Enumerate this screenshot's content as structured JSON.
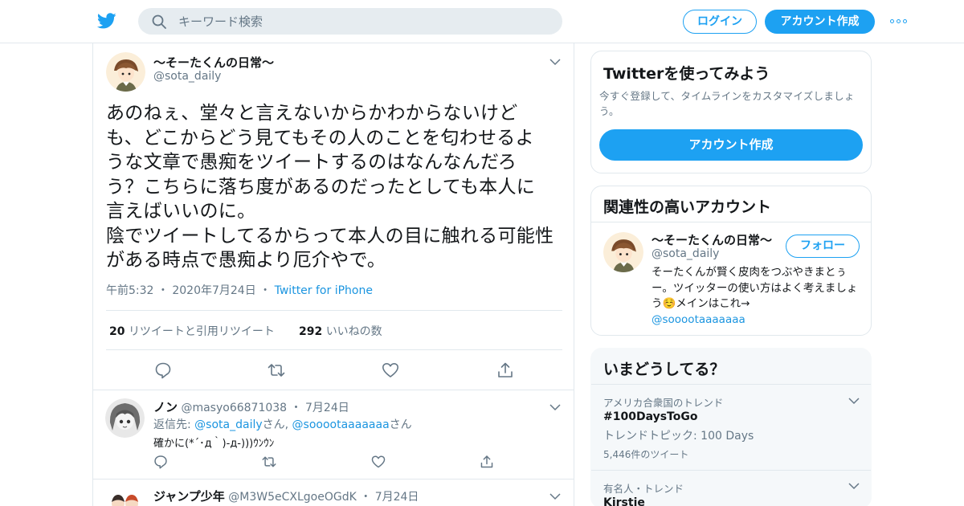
{
  "header": {
    "search_placeholder": "キーワード検索",
    "login_label": "ログイン",
    "signup_label": "アカウント作成"
  },
  "tweet": {
    "display_name": "〜そーたくんの日常〜",
    "handle": "@sota_daily",
    "text": "あのねぇ、堂々と言えないからかわからないけど\nも、どこからどう見てもその人のことを匂わせるよ\nうな文章で愚痴をツイートするのはなんなんだろ\nう？こちらに落ち度があるのだったとしても本人に\n言えばいいのに。\n陰でツイートしてるからって本人の目に触れる可能性\nがある時点で愚痴より厄介やで。",
    "time": "午前5:32",
    "date": "2020年7月24日",
    "source": "Twitter for iPhone",
    "retweets_count": "20",
    "retweets_label": "リツイートと引用リツイート",
    "likes_count": "292",
    "likes_label": "いいねの数"
  },
  "replies": [
    {
      "name": "ノン",
      "handle": "@masyo66871038",
      "date": "7月24日",
      "reply_to_prefix": "返信先: ",
      "reply_to_1": "@sota_daily",
      "san_1": "さん",
      "sep": ", ",
      "reply_to_2": "@sooootaaaaaaa",
      "san_2": "さん",
      "text": "確かに(*´･д｀)-д-)))ｳﾝｳﾝ"
    },
    {
      "name": "ジャンプ少年",
      "handle": "@M3W5eCXLgoeOGdK",
      "date": "7月24日"
    }
  ],
  "signup_card": {
    "title": "Twitterを使ってみよう",
    "desc": "今すぐ登録して、タイムラインをカスタマイズしましょう。",
    "button": "アカウント作成"
  },
  "related": {
    "title": "関連性の高いアカウント",
    "name": "〜そーたくんの日常〜",
    "handle": "@sota_daily",
    "follow": "フォロー",
    "bio": "そーたくんが賢く皮肉をつぶやきまとぅー。ツイッターの使い方はよく考えましょう☺️メインはこれ→",
    "bio_link": "@sooootaaaaaaa"
  },
  "trends": {
    "title": "いまどうしてる？",
    "items": [
      {
        "context": "アメリカ合衆国のトレンド",
        "name": "#100DaysToGo",
        "topic": "トレンドトピック: 100 Days",
        "count": "5,446件のツイート"
      },
      {
        "context": "有名人・トレンド",
        "name": "Kirstie"
      }
    ]
  },
  "colors": {
    "brand": "#1da1f2",
    "link": "#1b95e0",
    "secondary": "#657786",
    "border": "#e1e8ed"
  },
  "icons": [
    "twitter-bird-icon",
    "search-icon",
    "more-icon",
    "chevron-down-icon",
    "reply-icon",
    "retweet-icon",
    "like-icon",
    "share-icon"
  ]
}
